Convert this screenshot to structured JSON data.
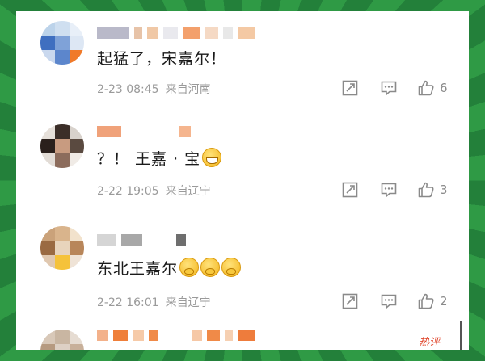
{
  "comments": [
    {
      "text": "起猛了，宋嘉尔！",
      "emoji": "",
      "date": "2-23 08:45",
      "source": "来自河南",
      "likes": "6"
    },
    {
      "text": "？！ 王嘉 · 宝",
      "emoji": "grinning-face",
      "date": "2-22 19:05",
      "source": "来自辽宁",
      "likes": "3"
    },
    {
      "text": "东北王嘉尔",
      "emoji": "thinking-face x3",
      "date": "2-22 16:01",
      "source": "来自辽宁",
      "likes": "2"
    }
  ],
  "partial_tag": "热评",
  "icons": [
    "share-icon",
    "comment-icon",
    "like-icon"
  ],
  "colors": {
    "meta_gray": "#9a9a9a",
    "text": "#1a1a1a",
    "frame_green": "#2e8b3e",
    "hot_red": "#e0452b"
  }
}
